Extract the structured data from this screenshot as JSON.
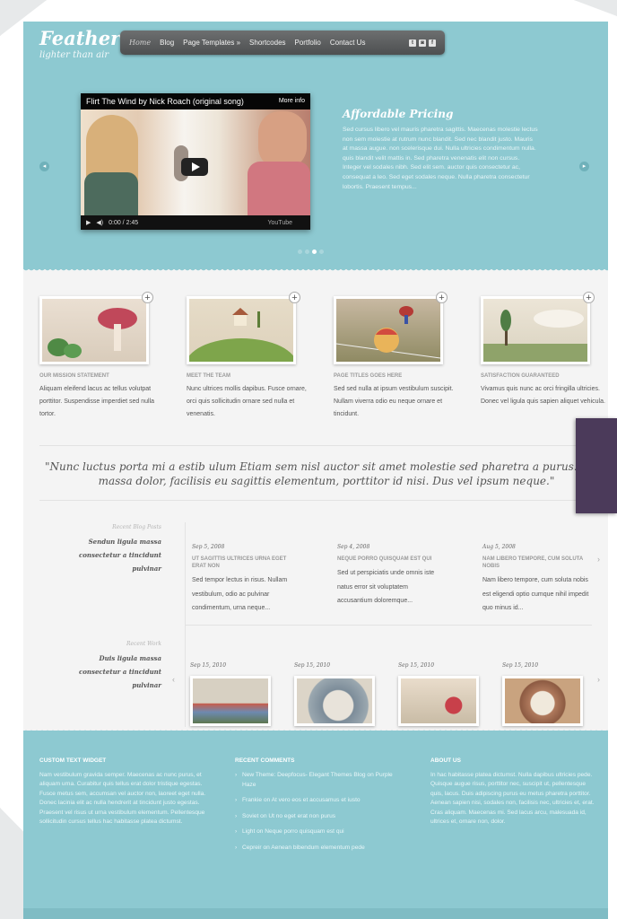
{
  "site": {
    "name": "Feather",
    "tagline": "lighter than air"
  },
  "nav": {
    "items": [
      "Home",
      "Blog",
      "Page Templates »",
      "Shortcodes",
      "Portfolio",
      "Contact Us"
    ],
    "active": "Home",
    "social_icons": [
      "twitter-icon",
      "rss-icon",
      "facebook-icon"
    ]
  },
  "video": {
    "title": "Flirt The Wind by Nick Roach (original song)",
    "more_info": "More info",
    "time": "0:00 / 2:45",
    "brand": "YouTube"
  },
  "hero": {
    "heading": "Affordable Pricing",
    "body": "Sed cursus libero vel mauris pharetra sagittis. Maecenas molestie lectus non sem molestie at rutrum nunc blandit. Sed nec blandit justo. Mauris at massa augue. non scelerisque dui. Nulla ultricies condimentum nulla. quis blandit velit mattis in. Sed pharetra venenatis elit non cursus. Integer vel sodales nibh. Sed elit sem. auctor quis consectetur ac, consequat a leo. Sed eget sodales neque. Nulla pharetra consectetur lobortis. Praesent tempus..."
  },
  "slider": {
    "dots": 4,
    "active_dot": 3
  },
  "features": [
    {
      "title": "OUR MISSION STATEMENT",
      "text": "Aliquam eleifend lacus ac tellus volutpat porttitor. Suspendisse imperdiet sed nulla tortor."
    },
    {
      "title": "MEET THE TEAM",
      "text": "Nunc ultrices mollis dapibus. Fusce ornare, orci quis sollicitudin ornare sed nulla et venenatis."
    },
    {
      "title": "PAGE TITLES GOES HERE",
      "text": "Sed sed nulla at ipsum vestibulum suscipit. Nullam viverra odio eu neque ornare et tincidunt."
    },
    {
      "title": "SATISFACTION GUARANTEED",
      "text": "Vivamus quis nunc ac orci fringilla ultricies. Donec vel ligula quis sapien aliquet vehicula."
    }
  ],
  "quote": {
    "line1": "\"Nunc luctus porta mi a estib ulum Etiam sem nisl auctor sit amet molestie sed pharetra a purus. Fusce",
    "line2": "massa dolor, facilisis eu sagittis elementum, porttitor id nisi. Dus vel ipsum neque.\""
  },
  "blog": {
    "label_small": "Recent Blog Posts",
    "label_big": "Sendun ligula massa consectetur a tincidunt pulvinar",
    "posts": [
      {
        "date": "Sep 5, 2008",
        "title": "UT SAGITTIS ULTRICES URNA EGET ERAT NON",
        "text": "Sed tempor lectus in risus. Nullam vestibulum, odio ac pulvinar condimentum, urna neque..."
      },
      {
        "date": "Sep 4, 2008",
        "title": "NEQUE PORRO QUISQUAM EST QUI",
        "text": "Sed ut perspiciatis unde omnis iste natus error sit voluptatem accusantium doloremque..."
      },
      {
        "date": "Aug 5, 2008",
        "title": "NAM LIBERO TEMPORE, CUM SOLUTA NOBIS",
        "text": "Nam libero tempore, cum soluta nobis est eligendi optio cumque nihil impedit quo minus id..."
      }
    ]
  },
  "work": {
    "label_small": "Recent Work",
    "label_big": "Duis ligula massa consectetur a tincidunt pulvinar",
    "items": [
      {
        "date": "Sep 15, 2010"
      },
      {
        "date": "Sep 15, 2010"
      },
      {
        "date": "Sep 15, 2010"
      },
      {
        "date": "Sep 15, 2010"
      }
    ]
  },
  "footer": {
    "col1": {
      "title": "CUSTOM TEXT WIDGET",
      "text": "Nam vestibulum gravida semper. Maecenas ac nunc purus, et aliquam urna. Curabitur quis tellus erat dolor tristique egestas. Fusce metus sem, accumsan vel auctor non, laoreet eget nulla. Donec lacinia elit ac nulla hendrerit at tincidunt justo egestas. Praesent vel risus ut urna vestibulum elementum. Pellentesque sollicitudin cursus tellus hac habitasse platea dictumst."
    },
    "col2": {
      "title": "RECENT COMMENTS",
      "items": [
        "New Theme: Deepfocus- Elegant Themes Blog on Purple Haze",
        "Frankie on At vero eos et accusamus et iusto",
        "Soviet on Ut no eget erat non purus",
        "Light on Neque porro quisquam est qui",
        "Cepreir on Aenean bibendum elementum pede"
      ]
    },
    "col3": {
      "title": "ABOUT US",
      "text": "In hac habitasse platea dictumst. Nulla dapibus ultricies pede. Quisque augue risus, porttitor nec, suscipit ut, pellentesque quis, lacus. Duis adipiscing purus eu metus pharetra porttitor. Aenean sapien nisi, sodales non, facilisis nec, ultricies et, erat. Cras aliquam. Maecenas mi. Sed lacus arcu, malesuada id, ultrices et, ornare non, dolor."
    }
  },
  "colors": {
    "accent": "#8dc9d1",
    "ribbon": "#4b3a5a"
  }
}
